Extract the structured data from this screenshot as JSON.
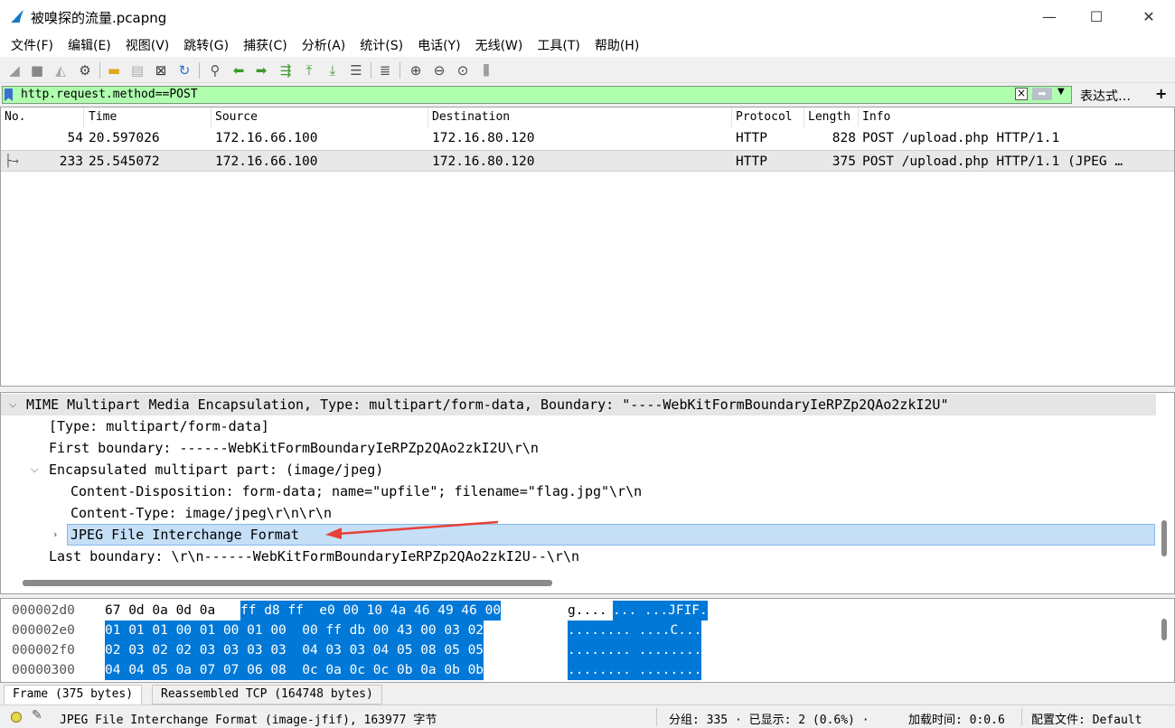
{
  "window": {
    "title": "被嗅探的流量.pcapng",
    "minimize": "—",
    "maximize": "☐",
    "close": "✕"
  },
  "menu": [
    "文件(F)",
    "编辑(E)",
    "视图(V)",
    "跳转(G)",
    "捕获(C)",
    "分析(A)",
    "统计(S)",
    "电话(Y)",
    "无线(W)",
    "工具(T)",
    "帮助(H)"
  ],
  "filter": {
    "value": "http.request.method==POST",
    "expression_label": "表达式…",
    "plus_label": "+"
  },
  "packet_list": {
    "columns": [
      "No.",
      "Time",
      "Source",
      "Destination",
      "Protocol",
      "Length",
      "Info"
    ],
    "rows": [
      {
        "no": "54",
        "time": "20.597026",
        "source": "172.16.66.100",
        "destination": "172.16.80.120",
        "protocol": "HTTP",
        "length": "828",
        "info": "POST /upload.php HTTP/1.1"
      },
      {
        "no": "233",
        "time": "25.545072",
        "source": "172.16.66.100",
        "destination": "172.16.80.120",
        "protocol": "HTTP",
        "length": "375",
        "info": "POST /upload.php HTTP/1.1  (JPEG …"
      }
    ]
  },
  "details": {
    "lines": [
      "MIME Multipart Media Encapsulation, Type: multipart/form-data, Boundary: \"----WebKitFormBoundaryIeRPZp2QAo2zkI2U\"",
      "[Type: multipart/form-data]",
      "First boundary: ------WebKitFormBoundaryIeRPZp2QAo2zkI2U\\r\\n",
      "Encapsulated multipart part:  (image/jpeg)",
      "Content-Disposition: form-data; name=\"upfile\"; filename=\"flag.jpg\"\\r\\n",
      "Content-Type: image/jpeg\\r\\n\\r\\n",
      "JPEG File Interchange Format",
      "Last boundary: \\r\\n------WebKitFormBoundaryIeRPZp2QAo2zkI2U--\\r\\n"
    ]
  },
  "bytes": {
    "rows": [
      {
        "offset": "000002d0",
        "plain_hex": "67 0d 0a 0d 0a",
        "sel_hex": "ff d8 ff  e0 00 10 4a 46 49 46 00",
        "plain_ascii": "g....",
        "sel_ascii": "... ...JFIF."
      },
      {
        "offset": "000002e0",
        "plain_hex": "",
        "sel_hex": "01 01 01 00 01 00 01 00  00 ff db 00 43 00 03 02",
        "plain_ascii": "",
        "sel_ascii": "........ ....C..."
      },
      {
        "offset": "000002f0",
        "plain_hex": "",
        "sel_hex": "02 03 02 02 03 03 03 03  04 03 03 04 05 08 05 05",
        "plain_ascii": "",
        "sel_ascii": "........ ........"
      },
      {
        "offset": "00000300",
        "plain_hex": "",
        "sel_hex": "04 04 05 0a 07 07 06 08  0c 0a 0c 0c 0b 0a 0b 0b",
        "plain_ascii": "",
        "sel_ascii": "........ ........"
      }
    ]
  },
  "byte_tabs": [
    "Frame (375 bytes)",
    "Reassembled TCP (164748 bytes)"
  ],
  "status": {
    "field_info": "JPEG File Interchange Format (image-jfif), 163977 字节",
    "packets": "分组: 335 · 已显示: 2 (0.6%) ·",
    "load_time": "加载时间: 0:0.6",
    "profile": "配置文件: Default"
  },
  "colors": {
    "filter_bg": "#afffaf",
    "selected_field": "#c5dff7",
    "byte_selection": "#0078d7",
    "arrow": "#e8403a"
  }
}
